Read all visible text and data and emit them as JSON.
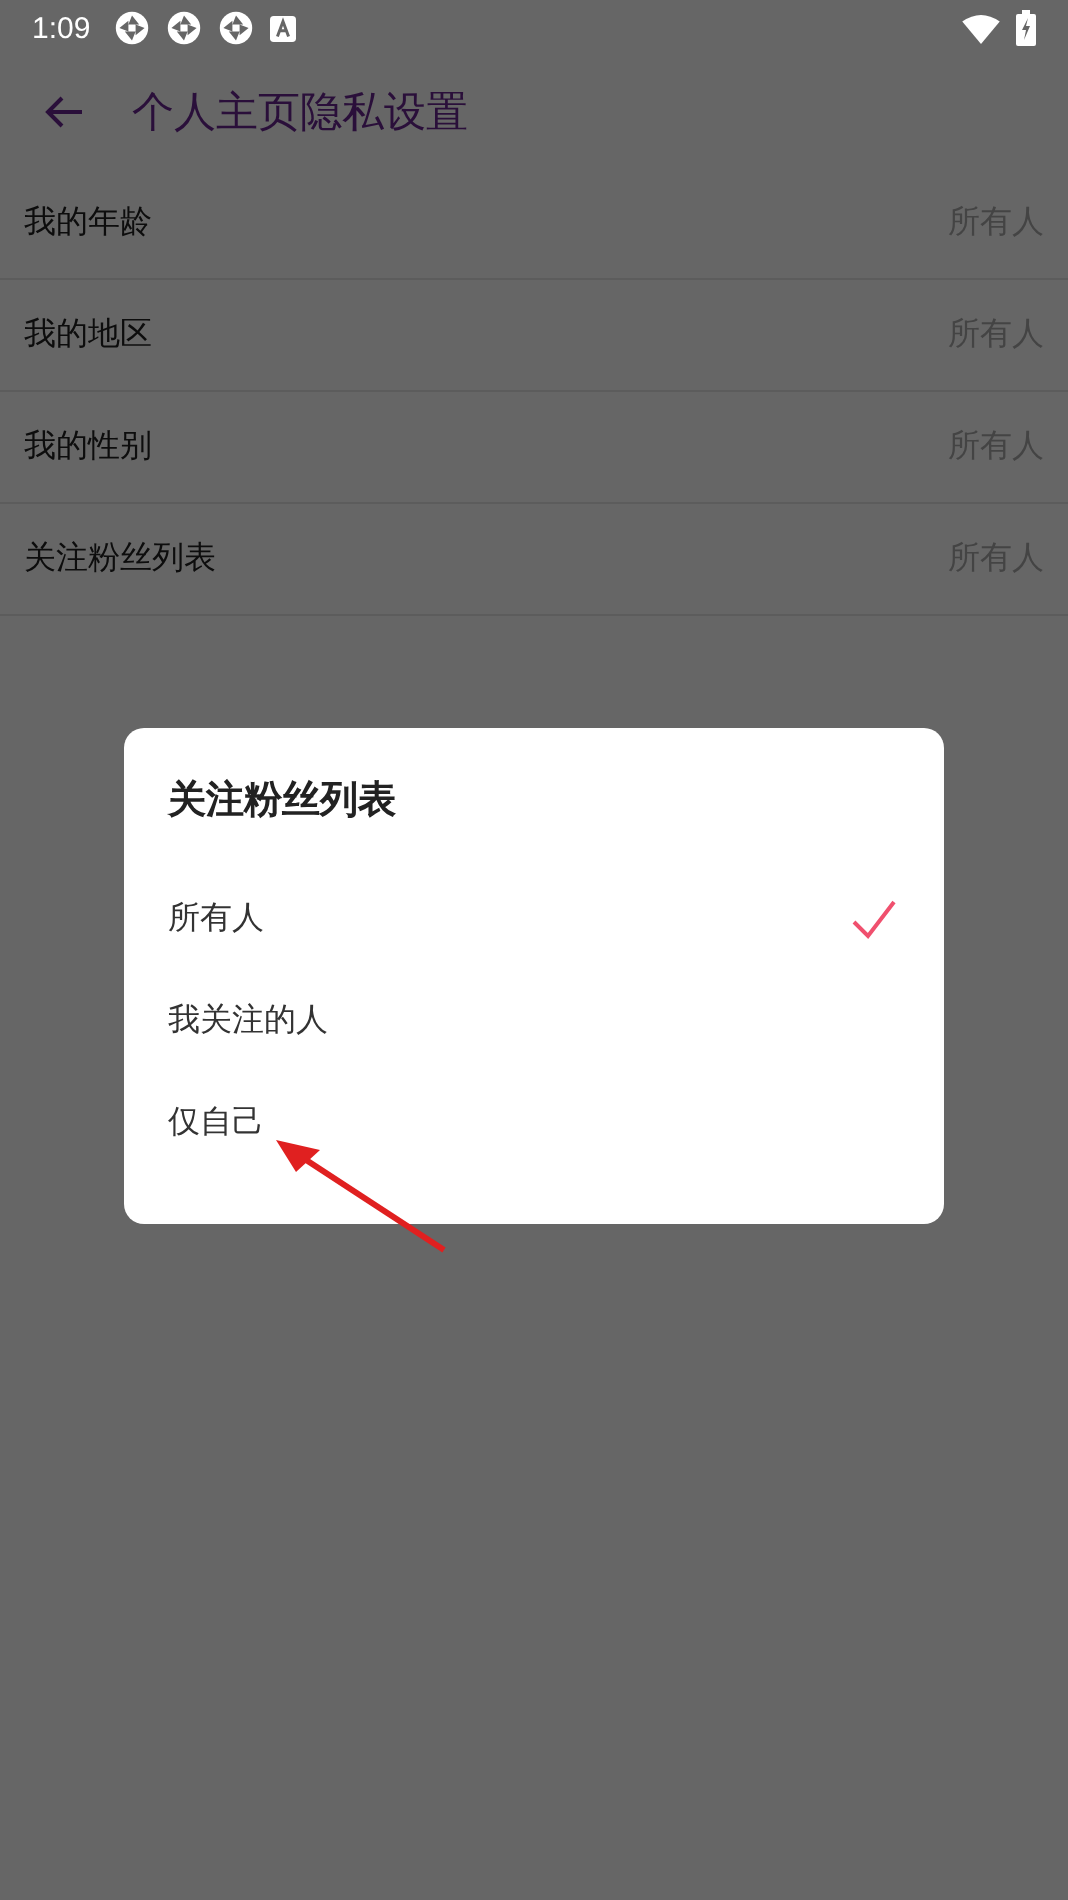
{
  "status_bar": {
    "time": "1:09",
    "notification_icons": [
      {
        "kind": "aperture"
      },
      {
        "kind": "aperture"
      },
      {
        "kind": "aperture"
      },
      {
        "kind": "a"
      }
    ]
  },
  "header": {
    "title": "个人主页隐私设置"
  },
  "settings": [
    {
      "label": "我的年龄",
      "value": "所有人"
    },
    {
      "label": "我的地区",
      "value": "所有人"
    },
    {
      "label": "我的性别",
      "value": "所有人"
    },
    {
      "label": "关注粉丝列表",
      "value": "所有人"
    }
  ],
  "dialog": {
    "title": "关注粉丝列表",
    "options": [
      {
        "label": "所有人",
        "selected": true
      },
      {
        "label": "我关注的人",
        "selected": false
      },
      {
        "label": "仅自己",
        "selected": false
      }
    ]
  }
}
